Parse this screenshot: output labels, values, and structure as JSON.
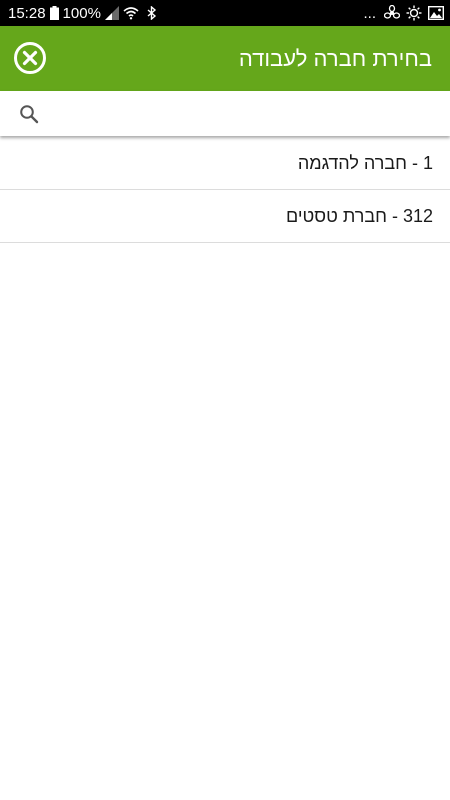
{
  "status_bar": {
    "time": "15:28",
    "battery_percent": "100%",
    "more": "...",
    "icons": [
      "battery-icon",
      "signal-icon",
      "wifi-icon",
      "bluetooth-icon",
      "fan-icon",
      "brightness-icon",
      "image-icon"
    ]
  },
  "app_bar": {
    "title": "בחירת חברה לעבודה",
    "close_icon": "close-circle-icon"
  },
  "search": {
    "icon": "search-icon",
    "value": "",
    "placeholder": ""
  },
  "companies": [
    {
      "label": "1 - חברה להדגמה"
    },
    {
      "label": "312 - חברת טסטים"
    }
  ],
  "colors": {
    "app_bar": "#65a71b",
    "status_bar": "#000000",
    "divider": "#dcdcdc",
    "text": "#1a1a1a"
  }
}
